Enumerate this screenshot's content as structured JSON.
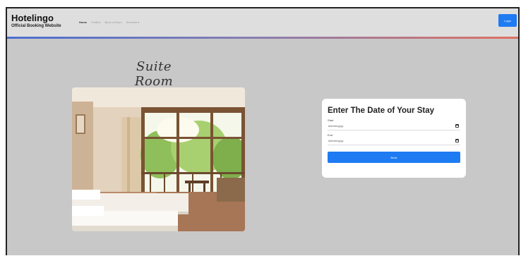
{
  "navbar": {
    "brand_title": "Hotelingo",
    "brand_subtitle": "Official Booking Website",
    "links": [
      {
        "label": "Home"
      },
      {
        "label": "Profiles"
      },
      {
        "label": "Book a Room"
      },
      {
        "label": "Services ▾"
      }
    ],
    "login_label": "Login",
    "accent_colors": [
      "#4b6fd0",
      "#e07060"
    ]
  },
  "room_title": "Suite Room",
  "booking_card": {
    "title": "Enter The Date of Your Stay",
    "start_label": "Start",
    "start_value": "dd/mm/yyyy",
    "end_label": "End",
    "end_value": "dd/mm/yyyy",
    "book_label": "Book"
  },
  "colors": {
    "page_background": "#c8c8c8",
    "primary_button": "#1e7bf2"
  }
}
